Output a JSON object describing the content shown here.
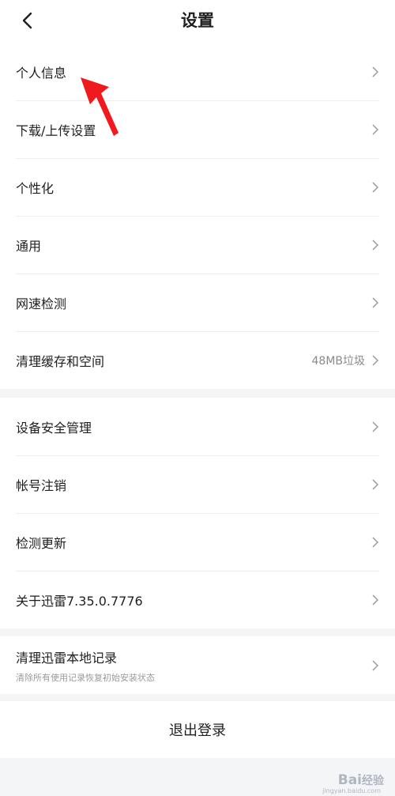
{
  "header": {
    "title": "设置"
  },
  "group1": [
    {
      "label": "个人信息"
    },
    {
      "label": "下载/上传设置"
    },
    {
      "label": "个性化"
    },
    {
      "label": "通用"
    },
    {
      "label": "网速检测"
    },
    {
      "label": "清理缓存和空间",
      "value": "48MB垃圾"
    }
  ],
  "group2": [
    {
      "label": "设备安全管理"
    },
    {
      "label": "帐号注销"
    },
    {
      "label": "检测更新"
    },
    {
      "label": "关于迅雷7.35.0.7776"
    }
  ],
  "group3": {
    "label": "清理迅雷本地记录",
    "sub": "清除所有使用记录恢复初始安装状态"
  },
  "logout": {
    "label": "退出登录"
  },
  "annotation": {
    "color": "#f0191e"
  },
  "watermark": {
    "brand": "Bai经验",
    "url": "jingyan.baidu.com"
  }
}
